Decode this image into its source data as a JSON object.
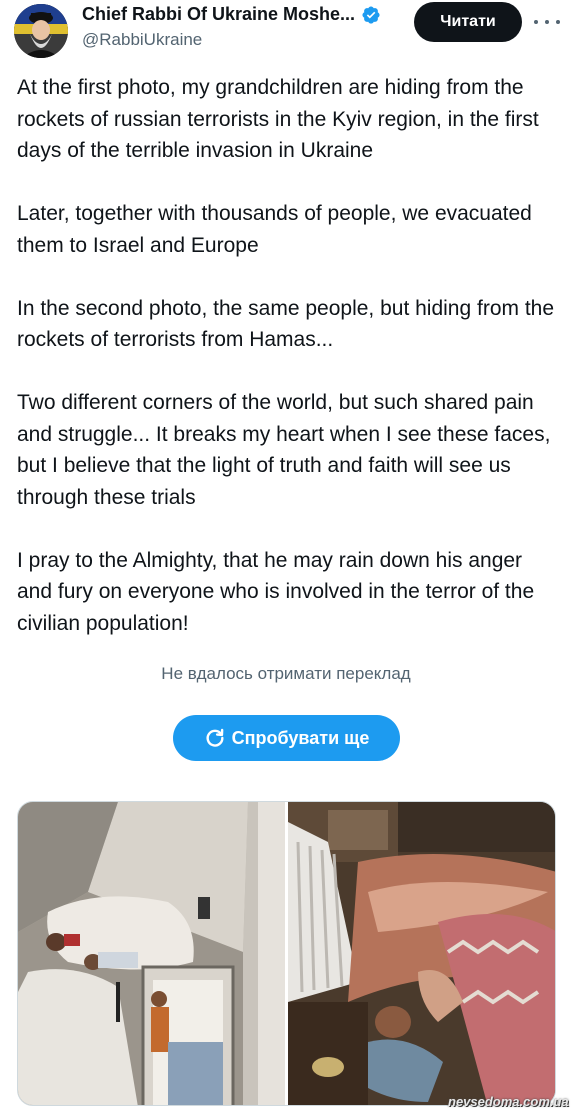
{
  "author": {
    "name": "Chief Rabbi Of Ukraine Moshe...",
    "handle": "@RabbiUkraine",
    "verified": true,
    "avatar_icon": "avatar-portrait-icon"
  },
  "actions": {
    "follow_label": "Читати",
    "more_icon": "more-dots-icon"
  },
  "tweet": {
    "paragraphs": [
      "At the first photo, my grandchildren are hiding from the rockets of russian terrorists in the Kyiv region, in the first days of the terrible invasion in Ukraine",
      "Later, together with thousands of people, we evacuated them to Israel and Europe",
      "In the second photo, the same people, but hiding from the rockets of terrorists from Hamas...",
      "Two different corners of the world, but such shared pain and struggle... It breaks my heart when I see these faces, but I believe that the light of truth and faith will see us through these trials",
      "I pray to the Almighty, that he may rain down his anger and fury on everyone who is involved in the terror of the civilian population!"
    ]
  },
  "translation": {
    "error_text": "Не вдалось отримати переклад",
    "retry_label": "Спробувати ще",
    "retry_icon": "refresh-icon"
  },
  "media": {
    "count": 2
  },
  "watermark": "nevsedoma.com.ua",
  "colors": {
    "accent": "#1d9bf0",
    "follow_bg": "#0f1419",
    "text": "#0f1419",
    "secondary_text": "#536471"
  }
}
